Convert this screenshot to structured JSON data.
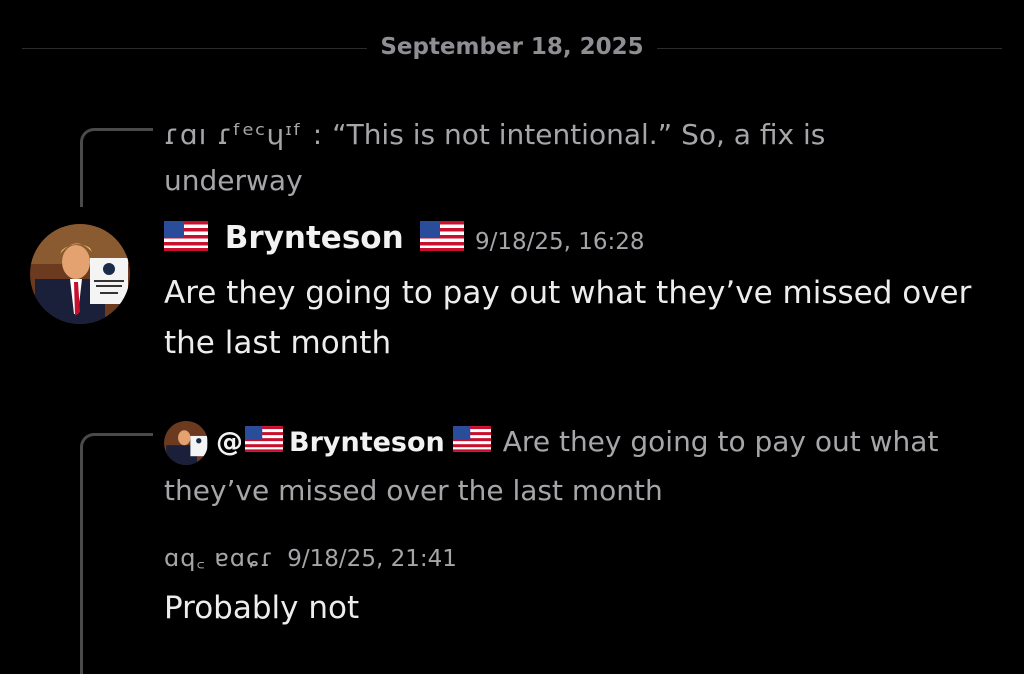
{
  "date_divider": "September 18, 2025",
  "reply1": {
    "author_redacted": "ɾɑı ɾᶠᵉᶜɥᶦᶠ :",
    "text_line1": "“This is not intentional.” So, a fix is",
    "text_line2": "underway"
  },
  "message1": {
    "username": "Brynteson",
    "flag_icon": "us-flag-icon",
    "timestamp": "9/18/25, 16:28",
    "text_line1": "Are they going to pay out what they’ve missed over",
    "text_line2": "the last month"
  },
  "reply2": {
    "mention_prefix": "@",
    "username": "Brynteson",
    "text_after": "Are they going to pay out what",
    "text_line2": "they’ve missed over the last month"
  },
  "message2": {
    "author_redacted": "ɑq꜀ ɐɑɕɾ",
    "timestamp": "9/18/25, 21:41",
    "text": "Probably not"
  },
  "colors": {
    "background": "#000000",
    "divider": "#2c2c2e",
    "muted": "#a6a6aa",
    "primary_text": "#ededed"
  }
}
